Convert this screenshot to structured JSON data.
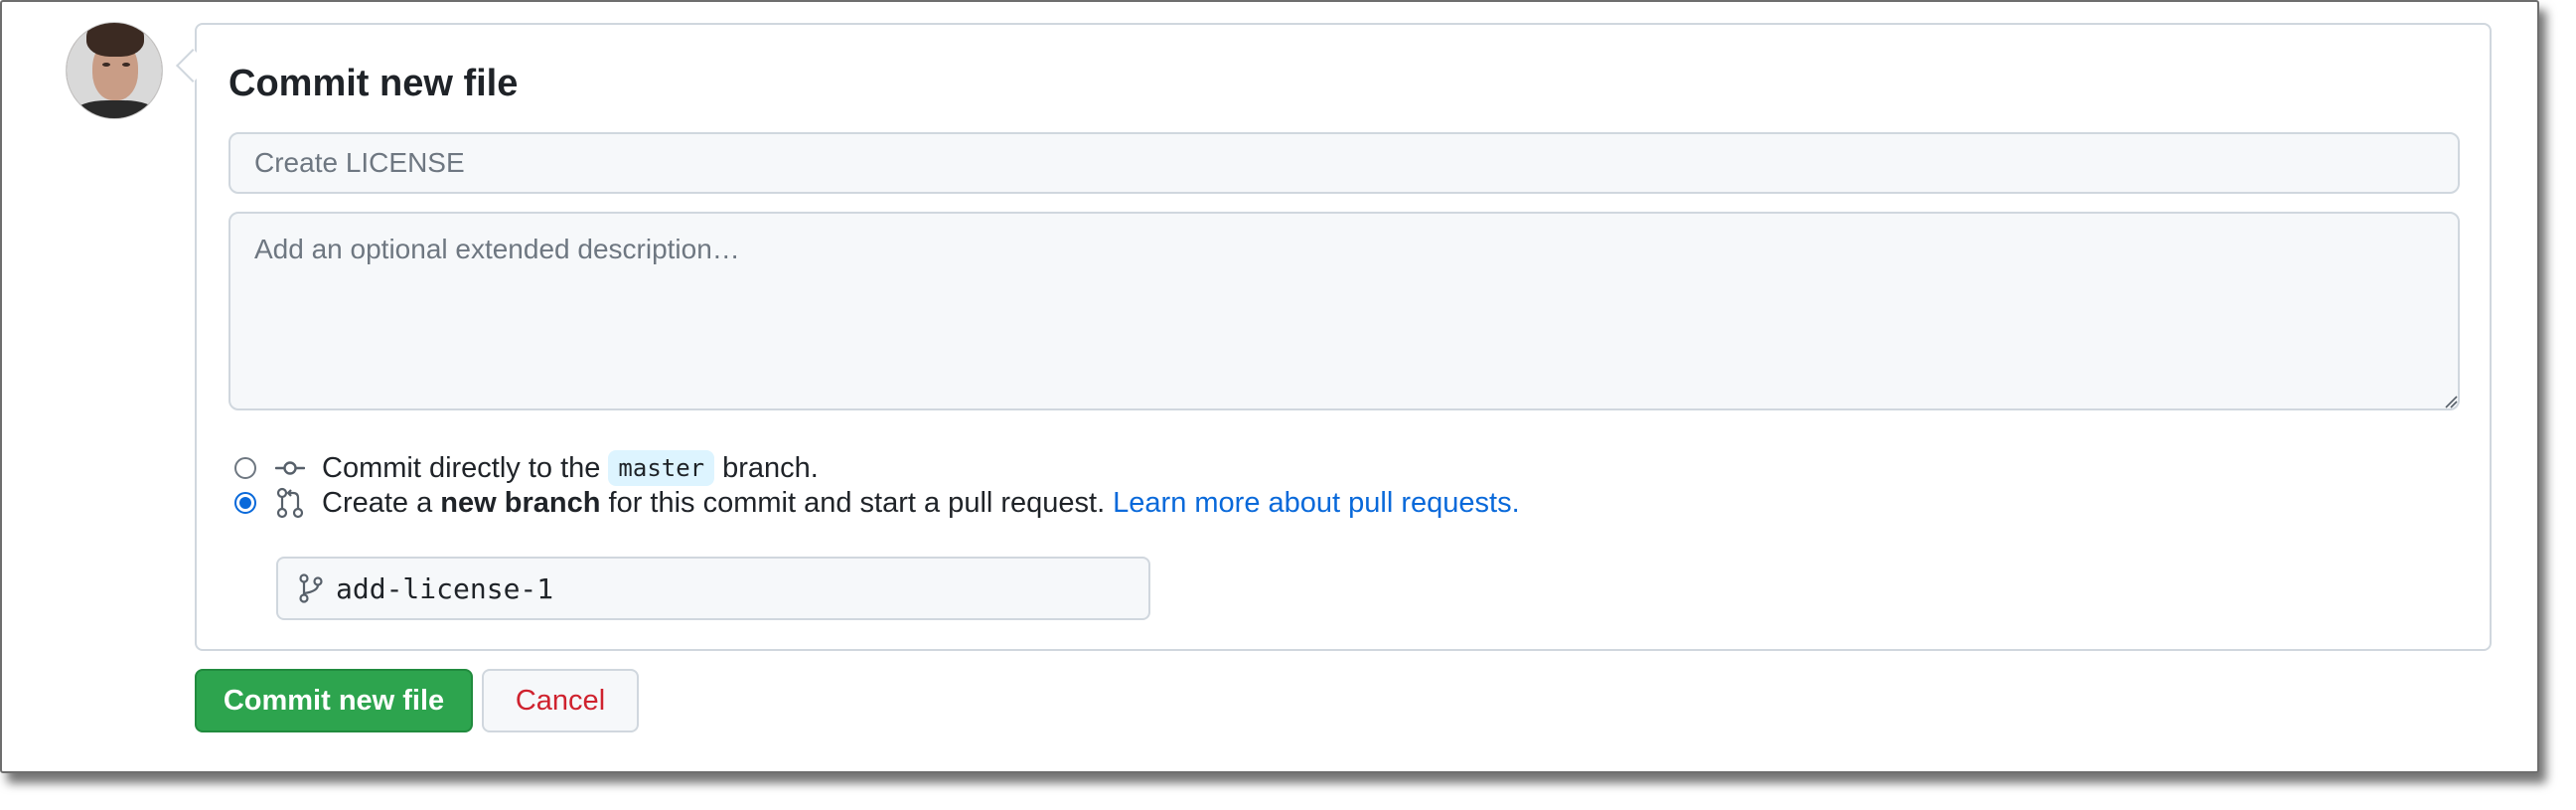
{
  "form": {
    "title": "Commit new file",
    "summary_placeholder": "Create LICENSE",
    "description_placeholder": "Add an optional extended description…"
  },
  "options": {
    "direct": {
      "prefix": "Commit directly to the",
      "branch": "master",
      "suffix": "branch.",
      "checked": false,
      "icon": "git-commit-icon"
    },
    "new_branch": {
      "prefix": "Create a",
      "bold": "new branch",
      "suffix": "for this commit and start a pull request.",
      "link": "Learn more about pull requests.",
      "checked": true,
      "icon": "git-pull-request-icon"
    }
  },
  "branch_name": {
    "value": "add-license-1",
    "icon": "git-branch-icon"
  },
  "buttons": {
    "commit": "Commit new file",
    "cancel": "Cancel"
  },
  "colors": {
    "primary_green": "#2da44e",
    "link_blue": "#0969da",
    "danger_red": "#cf222e"
  }
}
